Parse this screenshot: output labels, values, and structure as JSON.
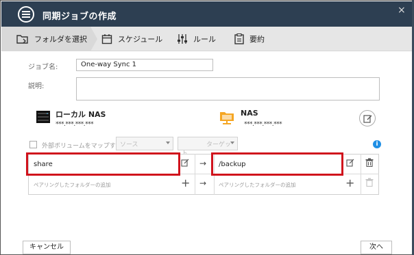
{
  "window": {
    "title": "同期ジョブの作成",
    "close_label": "×"
  },
  "steps": [
    {
      "label": "フォルダを選択",
      "icon": "folder-select-icon",
      "active": true
    },
    {
      "label": "スケジュール",
      "icon": "calendar-icon",
      "active": false
    },
    {
      "label": "ルール",
      "icon": "sliders-icon",
      "active": false
    },
    {
      "label": "要約",
      "icon": "summary-icon",
      "active": false
    }
  ],
  "form": {
    "job_name_label": "ジョブ名:",
    "job_name_value": "One-way Sync 1",
    "description_label": "説明:",
    "description_value": ""
  },
  "source": {
    "name": "ローカル NAS",
    "ip": "***.***.***.***",
    "icon": "nas-device-icon"
  },
  "destination": {
    "name": "NAS",
    "ip": "***.***.***.***",
    "icon": "remote-nas-icon"
  },
  "external_volume": {
    "label": "外部ボリュームをマップする",
    "select1": "ソース",
    "select2": "ターゲット",
    "checked": false
  },
  "pairs": [
    {
      "source": "share",
      "target": "/backup"
    }
  ],
  "add_row": {
    "source_hint": "ペアリングしたフォルダーの追加",
    "target_hint": "ペアリングしたフォルダーの追加"
  },
  "footer": {
    "cancel_label": "キャンセル",
    "next_label": "次へ"
  },
  "colors": {
    "titlebar": "#2d3f52",
    "highlight": "#d0121c",
    "info": "#1f8fe5",
    "nas_folder": "#f5a623"
  }
}
